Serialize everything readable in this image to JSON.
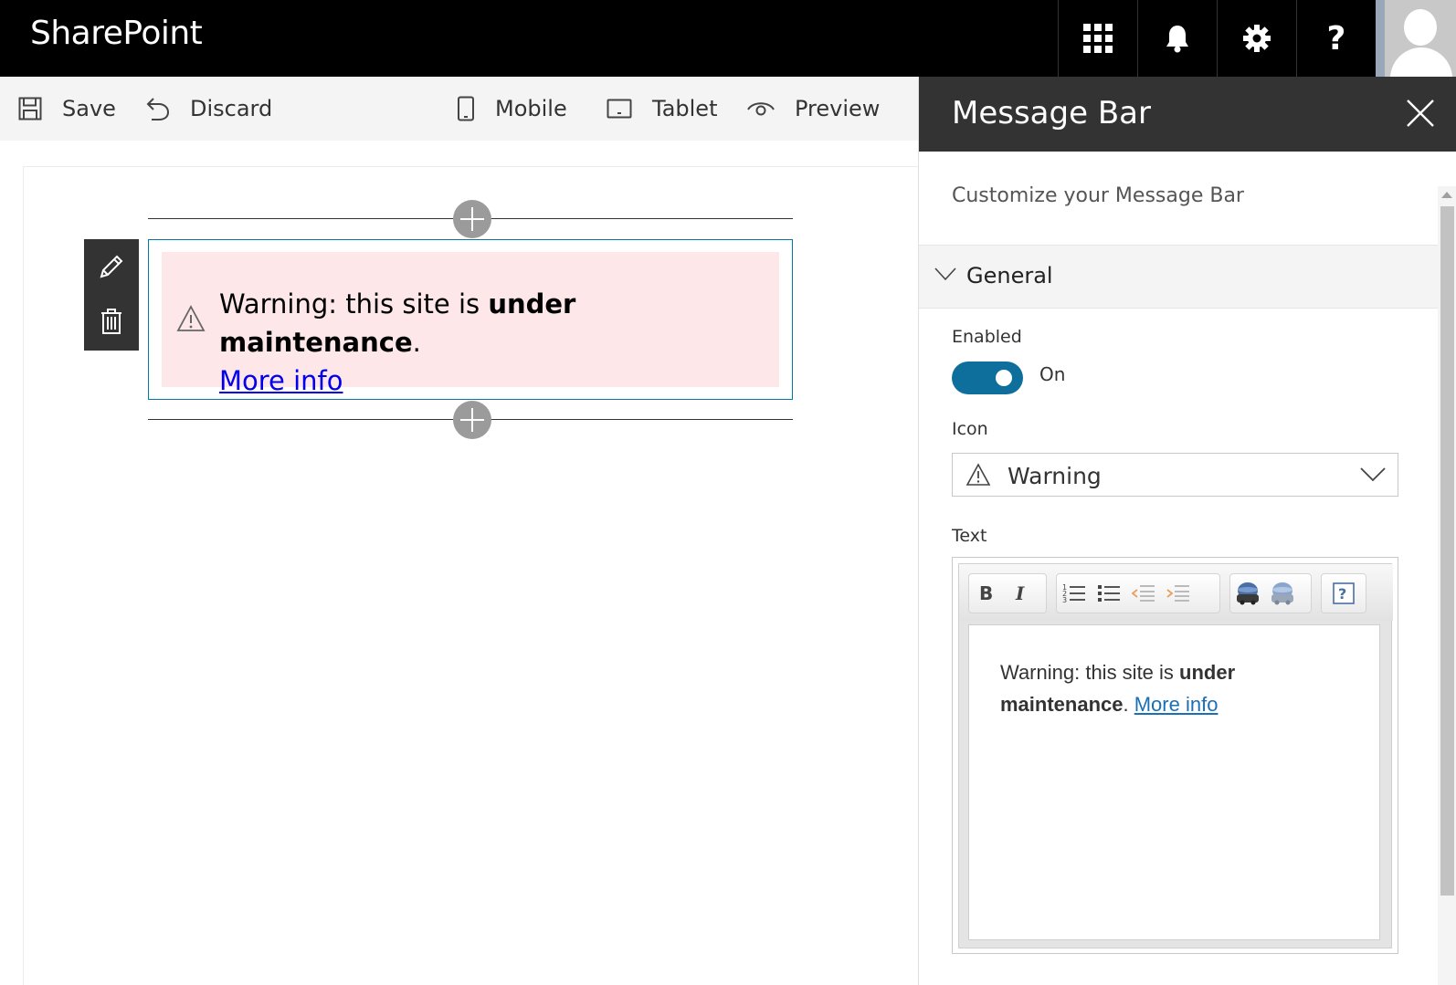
{
  "suitebar": {
    "brand": "SharePoint",
    "icons": [
      "app-launcher-icon",
      "bell-icon",
      "gear-icon",
      "help-icon"
    ],
    "help_label": "?"
  },
  "commandbar": {
    "save_label": "Save",
    "discard_label": "Discard",
    "mobile_label": "Mobile",
    "tablet_label": "Tablet",
    "preview_label": "Preview"
  },
  "canvas": {
    "message": {
      "prefix": "Warning: this site is ",
      "bold": "under maintenance",
      "suffix": ".",
      "link": "More info",
      "background": "#fde7e9"
    }
  },
  "pane": {
    "title": "Message Bar",
    "description": "Customize your Message Bar",
    "group_label": "General",
    "enabled_label": "Enabled",
    "toggle_text": "On",
    "icon_label": "Icon",
    "icon_value": "Warning",
    "text_label": "Text",
    "editor": {
      "prefix": "Warning: this site is ",
      "bold": "under maintenance",
      "suffix": ". ",
      "link": "More info"
    }
  },
  "colors": {
    "accent": "#0e6f9c",
    "selection_border": "#0078a8",
    "link": "#0000ee"
  }
}
